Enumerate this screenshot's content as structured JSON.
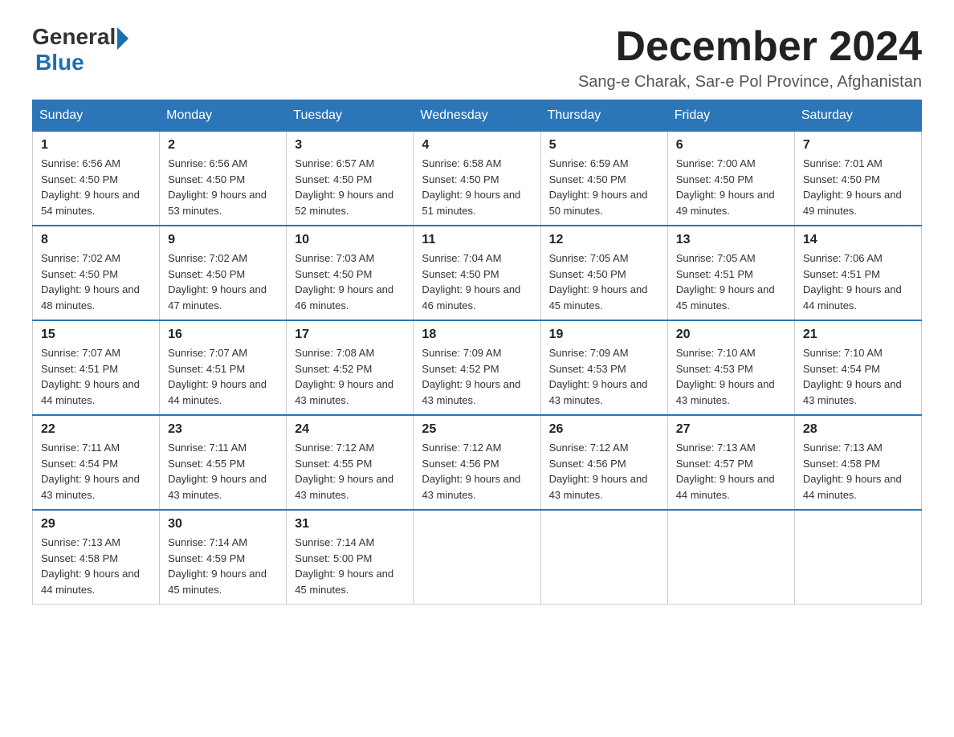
{
  "logo": {
    "general": "General",
    "blue": "Blue"
  },
  "title": "December 2024",
  "location": "Sang-e Charak, Sar-e Pol Province, Afghanistan",
  "days_of_week": [
    "Sunday",
    "Monday",
    "Tuesday",
    "Wednesday",
    "Thursday",
    "Friday",
    "Saturday"
  ],
  "weeks": [
    [
      {
        "day": "1",
        "sunrise": "6:56 AM",
        "sunset": "4:50 PM",
        "daylight": "9 hours and 54 minutes."
      },
      {
        "day": "2",
        "sunrise": "6:56 AM",
        "sunset": "4:50 PM",
        "daylight": "9 hours and 53 minutes."
      },
      {
        "day": "3",
        "sunrise": "6:57 AM",
        "sunset": "4:50 PM",
        "daylight": "9 hours and 52 minutes."
      },
      {
        "day": "4",
        "sunrise": "6:58 AM",
        "sunset": "4:50 PM",
        "daylight": "9 hours and 51 minutes."
      },
      {
        "day": "5",
        "sunrise": "6:59 AM",
        "sunset": "4:50 PM",
        "daylight": "9 hours and 50 minutes."
      },
      {
        "day": "6",
        "sunrise": "7:00 AM",
        "sunset": "4:50 PM",
        "daylight": "9 hours and 49 minutes."
      },
      {
        "day": "7",
        "sunrise": "7:01 AM",
        "sunset": "4:50 PM",
        "daylight": "9 hours and 49 minutes."
      }
    ],
    [
      {
        "day": "8",
        "sunrise": "7:02 AM",
        "sunset": "4:50 PM",
        "daylight": "9 hours and 48 minutes."
      },
      {
        "day": "9",
        "sunrise": "7:02 AM",
        "sunset": "4:50 PM",
        "daylight": "9 hours and 47 minutes."
      },
      {
        "day": "10",
        "sunrise": "7:03 AM",
        "sunset": "4:50 PM",
        "daylight": "9 hours and 46 minutes."
      },
      {
        "day": "11",
        "sunrise": "7:04 AM",
        "sunset": "4:50 PM",
        "daylight": "9 hours and 46 minutes."
      },
      {
        "day": "12",
        "sunrise": "7:05 AM",
        "sunset": "4:50 PM",
        "daylight": "9 hours and 45 minutes."
      },
      {
        "day": "13",
        "sunrise": "7:05 AM",
        "sunset": "4:51 PM",
        "daylight": "9 hours and 45 minutes."
      },
      {
        "day": "14",
        "sunrise": "7:06 AM",
        "sunset": "4:51 PM",
        "daylight": "9 hours and 44 minutes."
      }
    ],
    [
      {
        "day": "15",
        "sunrise": "7:07 AM",
        "sunset": "4:51 PM",
        "daylight": "9 hours and 44 minutes."
      },
      {
        "day": "16",
        "sunrise": "7:07 AM",
        "sunset": "4:51 PM",
        "daylight": "9 hours and 44 minutes."
      },
      {
        "day": "17",
        "sunrise": "7:08 AM",
        "sunset": "4:52 PM",
        "daylight": "9 hours and 43 minutes."
      },
      {
        "day": "18",
        "sunrise": "7:09 AM",
        "sunset": "4:52 PM",
        "daylight": "9 hours and 43 minutes."
      },
      {
        "day": "19",
        "sunrise": "7:09 AM",
        "sunset": "4:53 PM",
        "daylight": "9 hours and 43 minutes."
      },
      {
        "day": "20",
        "sunrise": "7:10 AM",
        "sunset": "4:53 PM",
        "daylight": "9 hours and 43 minutes."
      },
      {
        "day": "21",
        "sunrise": "7:10 AM",
        "sunset": "4:54 PM",
        "daylight": "9 hours and 43 minutes."
      }
    ],
    [
      {
        "day": "22",
        "sunrise": "7:11 AM",
        "sunset": "4:54 PM",
        "daylight": "9 hours and 43 minutes."
      },
      {
        "day": "23",
        "sunrise": "7:11 AM",
        "sunset": "4:55 PM",
        "daylight": "9 hours and 43 minutes."
      },
      {
        "day": "24",
        "sunrise": "7:12 AM",
        "sunset": "4:55 PM",
        "daylight": "9 hours and 43 minutes."
      },
      {
        "day": "25",
        "sunrise": "7:12 AM",
        "sunset": "4:56 PM",
        "daylight": "9 hours and 43 minutes."
      },
      {
        "day": "26",
        "sunrise": "7:12 AM",
        "sunset": "4:56 PM",
        "daylight": "9 hours and 43 minutes."
      },
      {
        "day": "27",
        "sunrise": "7:13 AM",
        "sunset": "4:57 PM",
        "daylight": "9 hours and 44 minutes."
      },
      {
        "day": "28",
        "sunrise": "7:13 AM",
        "sunset": "4:58 PM",
        "daylight": "9 hours and 44 minutes."
      }
    ],
    [
      {
        "day": "29",
        "sunrise": "7:13 AM",
        "sunset": "4:58 PM",
        "daylight": "9 hours and 44 minutes."
      },
      {
        "day": "30",
        "sunrise": "7:14 AM",
        "sunset": "4:59 PM",
        "daylight": "9 hours and 45 minutes."
      },
      {
        "day": "31",
        "sunrise": "7:14 AM",
        "sunset": "5:00 PM",
        "daylight": "9 hours and 45 minutes."
      },
      null,
      null,
      null,
      null
    ]
  ],
  "labels": {
    "sunrise_prefix": "Sunrise: ",
    "sunset_prefix": "Sunset: ",
    "daylight_prefix": "Daylight: "
  }
}
